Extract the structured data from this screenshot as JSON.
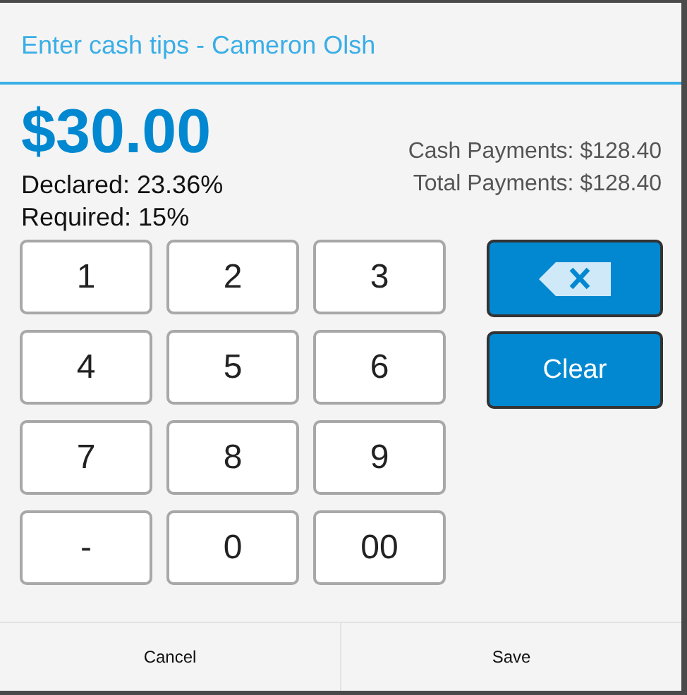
{
  "dialog": {
    "title": "Enter cash tips - Cameron Olsh"
  },
  "amount": "$30.00",
  "declared": "Declared: 23.36%",
  "required": "Required: 15%",
  "payments": [
    "Cash Payments: $128.40",
    "Total Payments: $128.40"
  ],
  "keys": [
    "1",
    "2",
    "3",
    "4",
    "5",
    "6",
    "7",
    "8",
    "9",
    "-",
    "0",
    "00"
  ],
  "clear_button": "Clear",
  "footer_buttons": [
    "Cancel",
    "Save"
  ]
}
